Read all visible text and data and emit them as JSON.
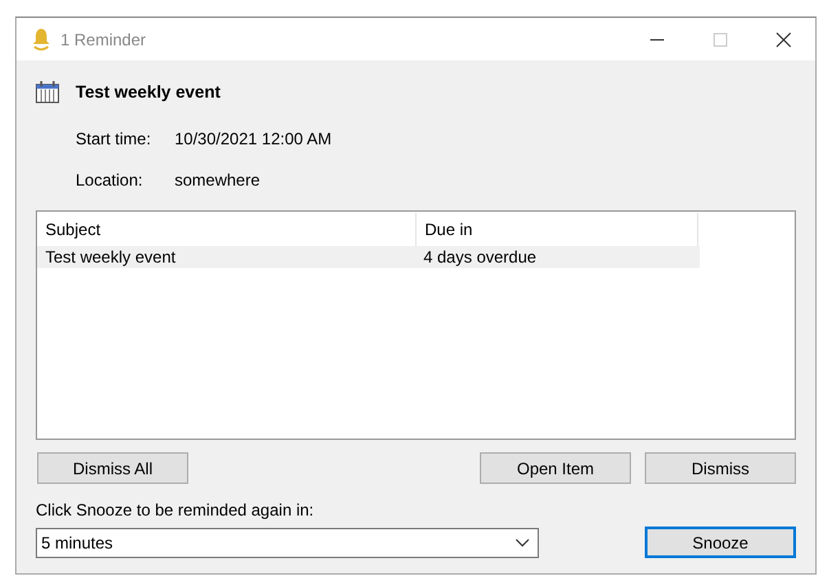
{
  "window": {
    "title": "1 Reminder"
  },
  "event": {
    "title": "Test weekly event",
    "fields": [
      {
        "label": "Start time:",
        "value": "10/30/2021 12:00 AM"
      },
      {
        "label": "Location:",
        "value": "somewhere"
      }
    ]
  },
  "table": {
    "columns": [
      "Subject",
      "Due in"
    ],
    "rows": [
      {
        "cells": [
          "Test weekly event",
          "4 days overdue"
        ],
        "selected": true
      }
    ]
  },
  "actions": {
    "left": [
      "Dismiss All"
    ],
    "right": [
      "Open Item",
      "Dismiss"
    ]
  },
  "snooze": {
    "prompt": "Click Snooze to be reminded again in:",
    "value": "5 minutes",
    "button": {
      "label": "Snooze",
      "focused": true
    }
  }
}
